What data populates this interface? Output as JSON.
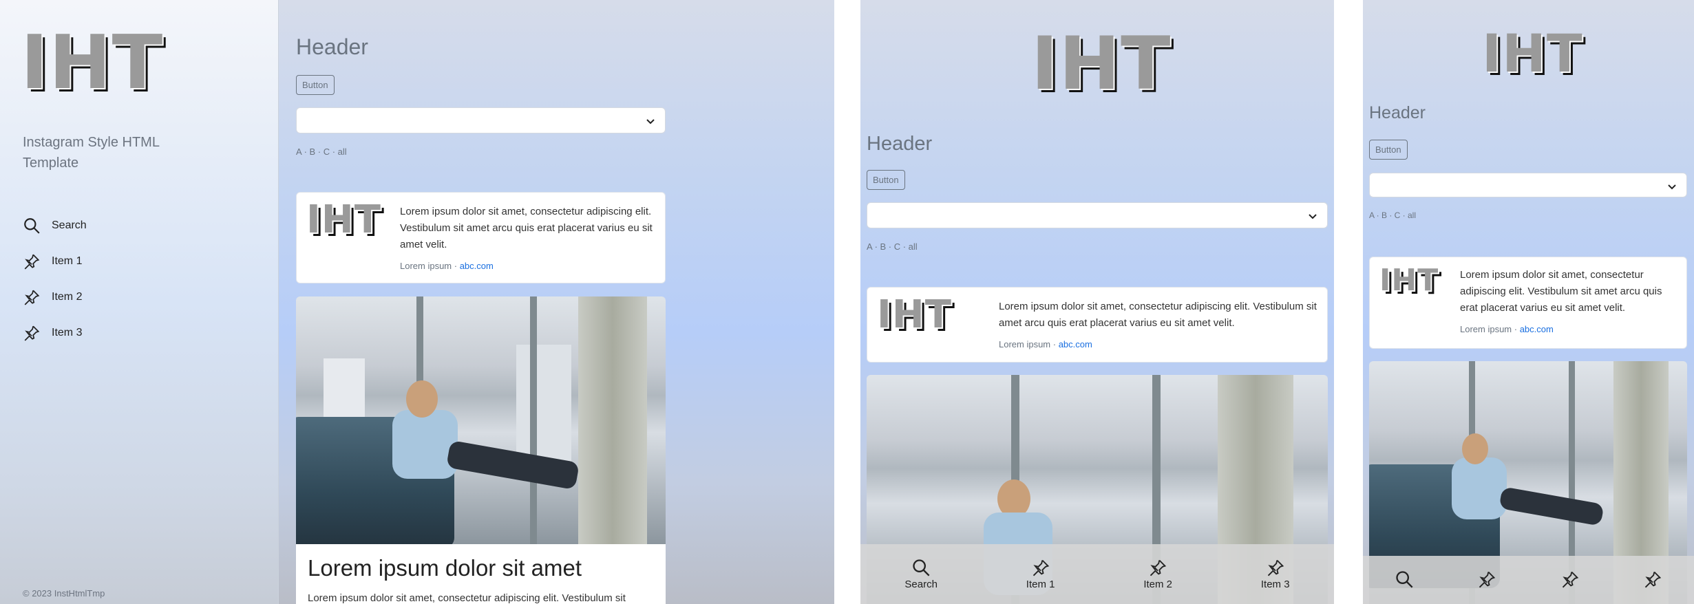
{
  "brand": {
    "logo": "IHT",
    "tagline": "Instagram Style HTML Template",
    "footer": "© 2023 InstHtmlTmp"
  },
  "nav": {
    "items": [
      {
        "label": "Search",
        "icon": "search-icon"
      },
      {
        "label": "Item 1",
        "icon": "pin-icon"
      },
      {
        "label": "Item 2",
        "icon": "pin-icon"
      },
      {
        "label": "Item 3",
        "icon": "pin-icon"
      }
    ]
  },
  "main": {
    "header": "Header",
    "button_label": "Button",
    "select_value": "",
    "filters": "A · B · C · all"
  },
  "card1": {
    "logo": "IHT",
    "text": "Lorem ipsum dolor sit amet, consectetur adipiscing elit. Vestibulum sit amet arcu quis erat placerat varius eu sit amet velit.",
    "meta_text": "Lorem ipsum · ",
    "meta_link": "abc.com"
  },
  "card2": {
    "title": "Lorem ipsum dolor sit amet",
    "text": "Lorem ipsum dolor sit amet, consectetur adipiscing elit. Vestibulum sit"
  },
  "colors": {
    "accent": "#1a6fe0",
    "muted": "#6a7480"
  }
}
